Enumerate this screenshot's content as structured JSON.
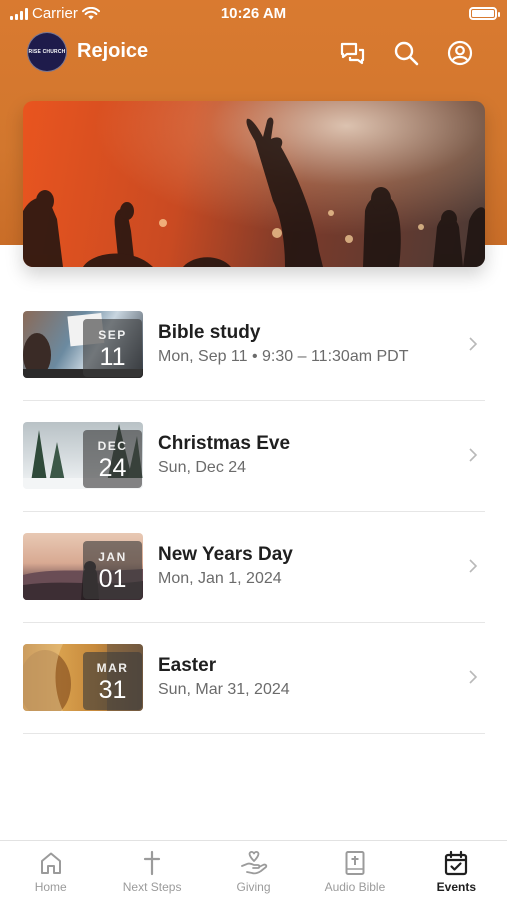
{
  "status_bar": {
    "carrier": "Carrier",
    "time": "10:26 AM"
  },
  "header": {
    "app_title": "Rejoice",
    "logo_text": "RISE CHURCH",
    "icons": [
      "chat-icon",
      "search-icon",
      "profile-icon"
    ]
  },
  "hero": {
    "image": "worship-concert-photo"
  },
  "events": [
    {
      "title": "Bible study",
      "date": "Mon, Sep 11 • 9:30 – 11:30am PDT",
      "month": "SEP",
      "day": "11"
    },
    {
      "title": "Christmas Eve",
      "date": "Sun, Dec 24",
      "month": "DEC",
      "day": "24"
    },
    {
      "title": "New Years Day",
      "date": "Mon, Jan 1, 2024",
      "month": "JAN",
      "day": "01"
    },
    {
      "title": "Easter",
      "date": "Sun, Mar 31, 2024",
      "month": "MAR",
      "day": "31"
    }
  ],
  "tabs": [
    {
      "label": "Home",
      "icon": "home-icon"
    },
    {
      "label": "Next Steps",
      "icon": "cross-icon"
    },
    {
      "label": "Giving",
      "icon": "giving-hand-icon"
    },
    {
      "label": "Audio Bible",
      "icon": "bible-icon"
    },
    {
      "label": "Events",
      "icon": "calendar-icon",
      "active": true
    }
  ],
  "colors": {
    "brand": "#d97a30",
    "text": "#1f1f1f",
    "muted": "#6b6b6b",
    "tab_inactive": "#9b9b9b"
  }
}
